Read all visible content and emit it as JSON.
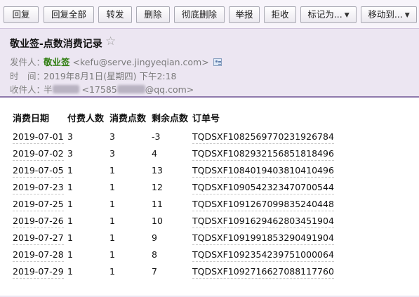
{
  "toolbar": {
    "buttons": [
      {
        "label": "回复"
      },
      {
        "label": "回复全部"
      },
      {
        "label": "转发"
      },
      {
        "label": "删除"
      },
      {
        "label": "彻底删除"
      },
      {
        "label": "举报"
      },
      {
        "label": "拒收"
      },
      {
        "label": "标记为...",
        "dropdown": true
      },
      {
        "label": "移动到...",
        "dropdown": true
      }
    ],
    "caret_glyph": "▼"
  },
  "email": {
    "subject": "敬业签-点数消费记录",
    "star_glyph": "☆",
    "sender_label": "发件人：",
    "sender_name": "敬业签",
    "sender_email": "<kefu@serve.jingyeqian.com>",
    "time_label": "时　间：",
    "time_value": "2019年8月1日(星期四) 下午2:18",
    "recipient_label": "收件人：",
    "recipient_name_visible": "半",
    "recipient_email_prefix": "<17585",
    "recipient_email_suffix": "@qq.com>"
  },
  "table": {
    "headers": [
      "消费日期",
      "付费人数",
      "消费点数",
      "剩余点数",
      "订单号"
    ],
    "rows": [
      [
        "2019-07-01",
        "3",
        "3",
        "-3",
        "TQDSXF1082569770231926784"
      ],
      [
        "2019-07-02",
        "3",
        "3",
        "4",
        "TQDSXF1082932156851818496"
      ],
      [
        "2019-07-05",
        "1",
        "1",
        "13",
        "TQDSXF1084019403810410496"
      ],
      [
        "2019-07-23",
        "1",
        "1",
        "12",
        "TQDSXF1090542323470700544"
      ],
      [
        "2019-07-25",
        "1",
        "1",
        "11",
        "TQDSXF1091267099835240448"
      ],
      [
        "2019-07-26",
        "1",
        "1",
        "10",
        "TQDSXF1091629462803451904"
      ],
      [
        "2019-07-27",
        "1",
        "1",
        "9",
        "TQDSXF1091991853290491904"
      ],
      [
        "2019-07-28",
        "1",
        "1",
        "8",
        "TQDSXF1092354239751000064"
      ],
      [
        "2019-07-29",
        "1",
        "1",
        "7",
        "TQDSXF1092716627088117760"
      ]
    ]
  },
  "colors": {
    "header_bg": "#ece6f2",
    "header_border": "#8f79ad",
    "sender_name": "#2e7d0f",
    "toolbar_bg": "#f7f4fa"
  }
}
